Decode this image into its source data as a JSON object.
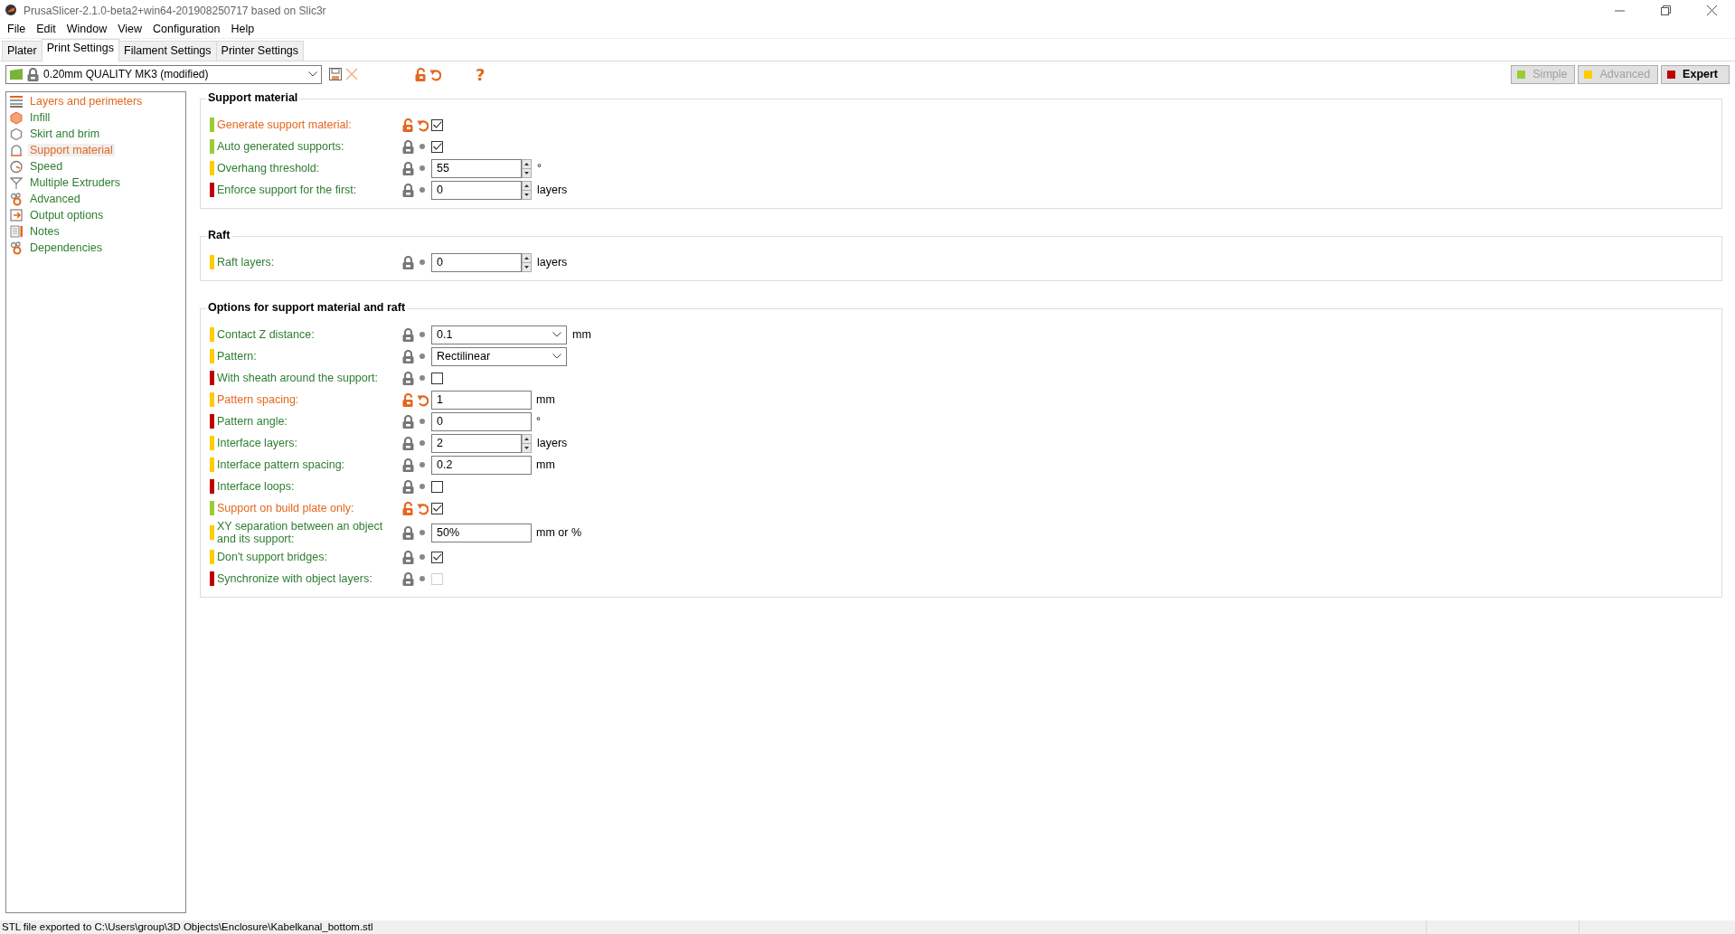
{
  "window": {
    "title": "PrusaSlicer-2.1.0-beta2+win64-201908250717 based on Slic3r"
  },
  "menu": [
    "File",
    "Edit",
    "Window",
    "View",
    "Configuration",
    "Help"
  ],
  "tabs": [
    {
      "label": "Plater",
      "selected": false
    },
    {
      "label": "Print Settings",
      "selected": true
    },
    {
      "label": "Filament Settings",
      "selected": false
    },
    {
      "label": "Printer Settings",
      "selected": false
    }
  ],
  "preset": {
    "name": "0.20mm QUALITY MK3 (modified)",
    "modified": true
  },
  "help_button": "?",
  "modes": [
    {
      "label": "Simple",
      "color": "#9acd32",
      "selected": false
    },
    {
      "label": "Advanced",
      "color": "#ffcc00",
      "selected": false
    },
    {
      "label": "Expert",
      "color": "#c00000",
      "selected": true
    }
  ],
  "sidebar": {
    "items": [
      {
        "label": "Layers and perimeters",
        "modified": true,
        "selected": false
      },
      {
        "label": "Infill",
        "modified": false,
        "selected": false
      },
      {
        "label": "Skirt and brim",
        "modified": false,
        "selected": false
      },
      {
        "label": "Support material",
        "modified": true,
        "selected": true
      },
      {
        "label": "Speed",
        "modified": false,
        "selected": false
      },
      {
        "label": "Multiple Extruders",
        "modified": false,
        "selected": false
      },
      {
        "label": "Advanced",
        "modified": false,
        "selected": false
      },
      {
        "label": "Output options",
        "modified": false,
        "selected": false
      },
      {
        "label": "Notes",
        "modified": false,
        "selected": false
      },
      {
        "label": "Dependencies",
        "modified": false,
        "selected": false
      }
    ]
  },
  "groups": [
    {
      "title": "Support material",
      "options": [
        {
          "kind": "checkbox",
          "label": "Generate support material:",
          "color": "#9acd32",
          "modified": true,
          "checked": true,
          "disabled": false
        },
        {
          "kind": "checkbox",
          "label": "Auto generated supports:",
          "color": "#9acd32",
          "modified": false,
          "checked": true,
          "disabled": false
        },
        {
          "kind": "spin",
          "label": "Overhang threshold:",
          "color": "#ffcc00",
          "modified": false,
          "value": "55",
          "unit": "°"
        },
        {
          "kind": "spin",
          "label": "Enforce support for the first:",
          "color": "#c00000",
          "modified": false,
          "value": "0",
          "unit": "layers"
        }
      ]
    },
    {
      "title": "Raft",
      "options": [
        {
          "kind": "spin",
          "label": "Raft layers:",
          "color": "#ffcc00",
          "modified": false,
          "value": "0",
          "unit": "layers"
        }
      ]
    },
    {
      "title": "Options for support material and raft",
      "options": [
        {
          "kind": "combo",
          "label": "Contact Z distance:",
          "color": "#ffcc00",
          "modified": false,
          "value": "0.1",
          "unit": "mm"
        },
        {
          "kind": "combo",
          "label": "Pattern:",
          "color": "#ffcc00",
          "modified": false,
          "value": "Rectilinear"
        },
        {
          "kind": "checkbox",
          "label": "With sheath around the support:",
          "color": "#c00000",
          "modified": false,
          "checked": false,
          "disabled": false
        },
        {
          "kind": "text",
          "label": "Pattern spacing:",
          "color": "#ffcc00",
          "modified": true,
          "value": "1",
          "unit": "mm"
        },
        {
          "kind": "text",
          "label": "Pattern angle:",
          "color": "#c00000",
          "modified": false,
          "value": "0",
          "unit": "°"
        },
        {
          "kind": "spin",
          "label": "Interface layers:",
          "color": "#ffcc00",
          "modified": false,
          "value": "2",
          "unit": "layers"
        },
        {
          "kind": "text",
          "label": "Interface pattern spacing:",
          "color": "#ffcc00",
          "modified": false,
          "value": "0.2",
          "unit": "mm"
        },
        {
          "kind": "checkbox",
          "label": "Interface loops:",
          "color": "#c00000",
          "modified": false,
          "checked": false,
          "disabled": false
        },
        {
          "kind": "checkbox",
          "label": "Support on build plate only:",
          "color": "#9acd32",
          "modified": true,
          "checked": true,
          "disabled": false
        },
        {
          "kind": "text",
          "label": "XY separation between an object and its support:",
          "color": "#ffcc00",
          "modified": false,
          "value": "50%",
          "unit": "mm or %"
        },
        {
          "kind": "checkbox",
          "label": "Don't support bridges:",
          "color": "#ffcc00",
          "modified": false,
          "checked": true,
          "disabled": false
        },
        {
          "kind": "checkbox",
          "label": "Synchronize with object layers:",
          "color": "#c00000",
          "modified": false,
          "checked": false,
          "disabled": true
        }
      ]
    }
  ],
  "status_bar": {
    "text": "STL file exported to C:\\Users\\group\\3D Objects\\Enclosure\\Kabelkanal_bottom.stl"
  }
}
